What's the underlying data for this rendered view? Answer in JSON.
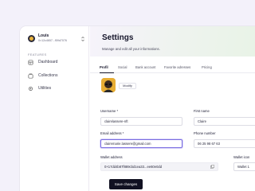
{
  "sidebar": {
    "user": {
      "name": "Louis",
      "wallet": "0×12c4657...f59d7076"
    },
    "section_label": "FEATURES",
    "items": [
      {
        "label": "Dashboard",
        "icon": "dashboard-icon"
      },
      {
        "label": "Collections",
        "icon": "collections-icon"
      },
      {
        "label": "Utilities",
        "icon": "utilities-icon"
      }
    ]
  },
  "main": {
    "title": "Settings",
    "subtitle": "Manage and edit all your informations.",
    "tabs": [
      "Profil",
      "Social",
      "Bank account",
      "Favorite adresses",
      "Pricing"
    ],
    "modify_label": "Modify",
    "fields": {
      "username": {
        "label": "Username *",
        "value": "clairelassere-nft"
      },
      "first_name": {
        "label": "First name",
        "value": "Claire"
      },
      "email": {
        "label": "Email address *",
        "value": "clairemarie.lassere@gmail.com"
      },
      "phone": {
        "label": "Phone number",
        "value": "06 25 98 67 63"
      },
      "wallet_address": {
        "label": "Wallet address",
        "value": "0×17dd4b87f889cbd1ea33...ee60e0dd"
      },
      "wallet_icon": {
        "label": "Wallet icon",
        "value": "Wallet 1"
      }
    },
    "save_label": "Save changes"
  },
  "colors": {
    "accent": "#7a6de0",
    "primary_button": "#111122",
    "background": "#f3f1fa"
  }
}
